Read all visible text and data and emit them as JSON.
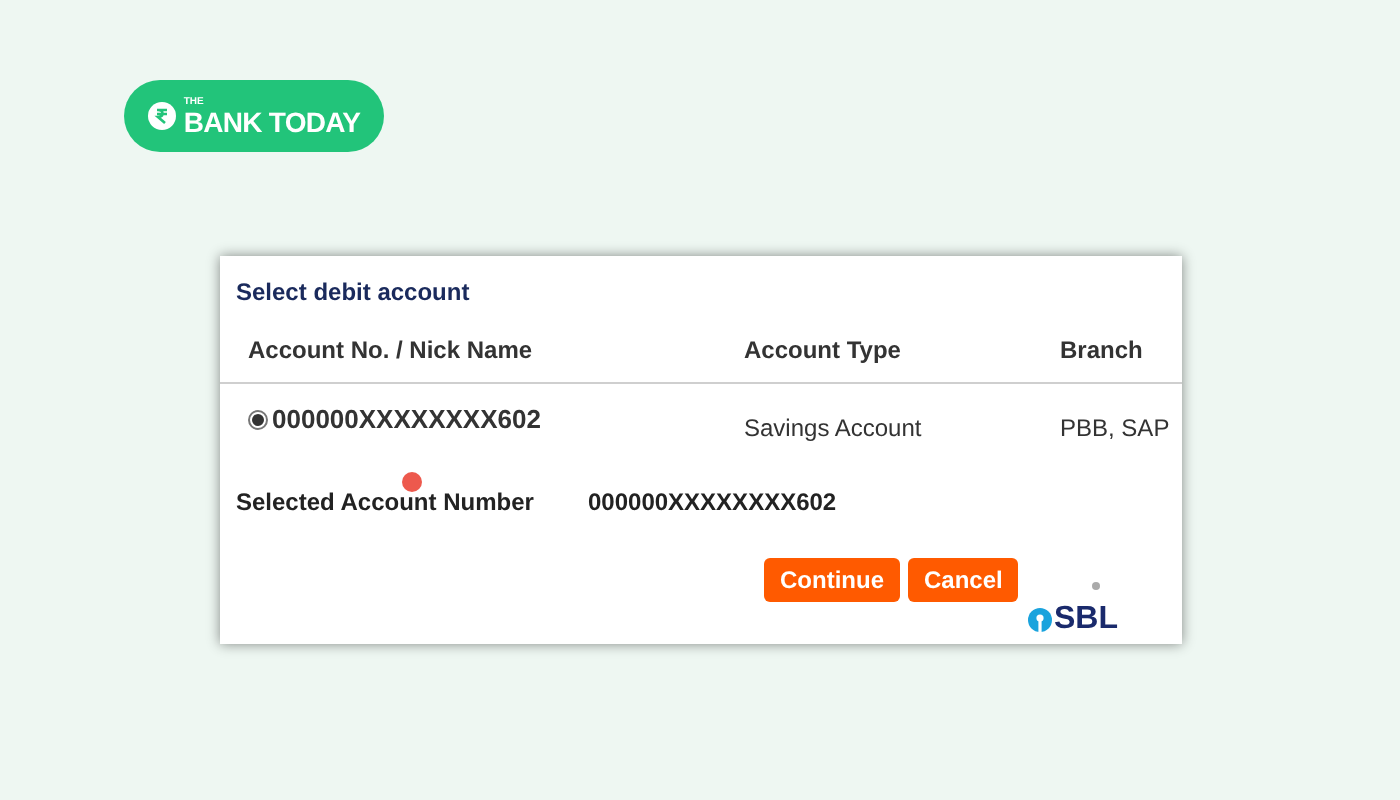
{
  "brand": {
    "small": "THE",
    "name": "BANK TODAY"
  },
  "panel": {
    "title": "Select debit account",
    "columns": [
      "Account No. / Nick Name",
      "Account Type",
      "Branch"
    ],
    "rows": [
      {
        "account": "000000XXXXXXXX602",
        "type": "Savings Account",
        "branch": "PBB, SAP",
        "selected": true
      }
    ],
    "selected_label": "Selected Account Number",
    "selected_value": "000000XXXXXXXX602",
    "buttons": [
      "Continue",
      "Cancel"
    ],
    "footer_logo": "SBL"
  }
}
